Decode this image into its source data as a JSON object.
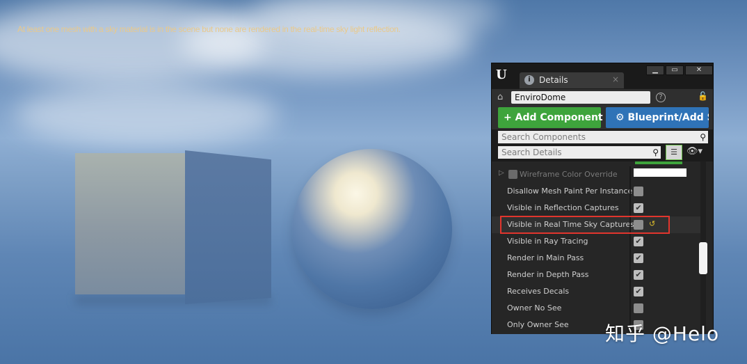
{
  "viewport": {
    "warning_text": "At least one mesh with a sky material is in the scene but none are rendered in the real-time sky light reflection."
  },
  "panel": {
    "tab_label": "Details",
    "tab_close": "×",
    "logo": "U",
    "window_buttons": [
      "▁",
      "▭",
      "✕"
    ],
    "actor_name": "EnviroDome",
    "help": "?",
    "add_component_label": "+ Add Component ▾",
    "blueprint_label": "Blueprint/Add Script",
    "search_components_placeholder": "Search Components",
    "search_details_placeholder": "Search Details",
    "properties": [
      {
        "label": "Wireframe Color Override",
        "type": "color",
        "dim": true
      },
      {
        "label": "Disallow Mesh Paint Per Instance",
        "checked": false
      },
      {
        "label": "Visible in Reflection Captures",
        "checked": true
      },
      {
        "label": "Visible in Real Time Sky Captures",
        "checked": false,
        "highlighted": true
      },
      {
        "label": "Visible in Ray Tracing",
        "checked": true
      },
      {
        "label": "Render in Main Pass",
        "checked": true
      },
      {
        "label": "Render in Depth Pass",
        "checked": true
      },
      {
        "label": "Receives Decals",
        "checked": true
      },
      {
        "label": "Owner No See",
        "checked": false
      },
      {
        "label": "Only Owner See",
        "checked": false
      }
    ]
  },
  "watermark": "知乎 @Helo",
  "icons": {
    "tab": "details-icon",
    "actor": "actor-icon",
    "lock": "lock-icon",
    "blueprint": "blueprint-gears-icon",
    "search": "search-icon",
    "list": "list-view-icon",
    "eye": "eye-icon",
    "reset": "reset-to-default-icon"
  },
  "colors": {
    "add_component": "#3ea43c",
    "blueprint": "#2f73b7",
    "highlight_border": "#e2352d",
    "warning_text": "#e9c98b"
  }
}
